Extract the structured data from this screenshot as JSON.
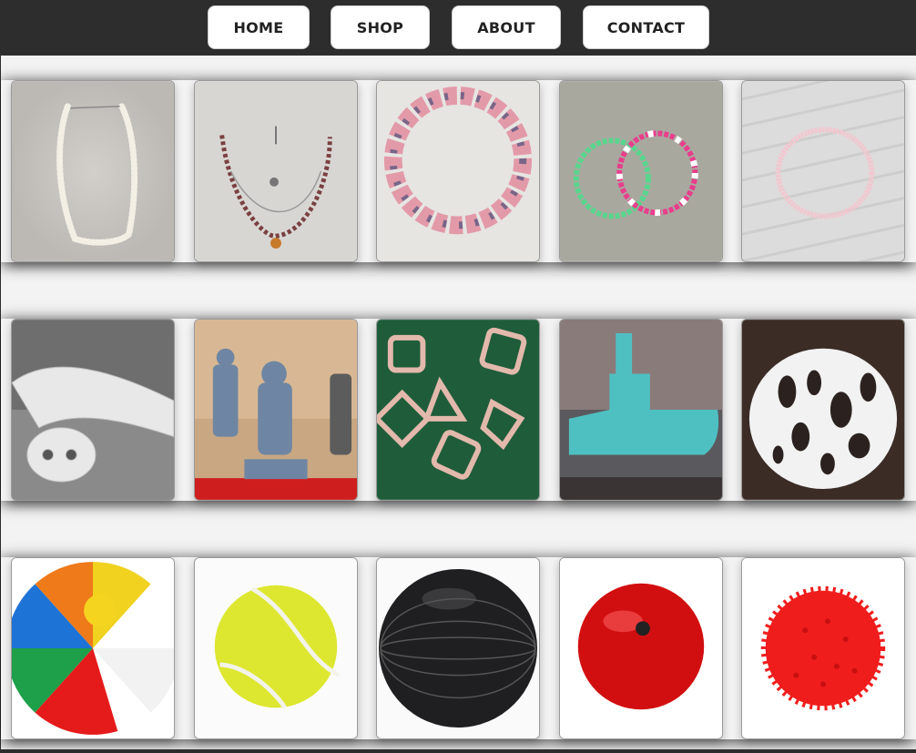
{
  "nav": {
    "items": [
      {
        "label": "HOME"
      },
      {
        "label": "SHOP"
      },
      {
        "label": "ABOUT"
      },
      {
        "label": "CONTACT"
      }
    ]
  },
  "rows": [
    {
      "items": [
        {
          "icon": "pearl-necklace-image"
        },
        {
          "icon": "beaded-pendant-necklace-image"
        },
        {
          "icon": "pink-bead-bracelet-image"
        },
        {
          "icon": "heart-letter-bracelets-image"
        },
        {
          "icon": "pink-seed-bracelet-image"
        }
      ]
    },
    {
      "items": [
        {
          "icon": "articulated-dragon-image"
        },
        {
          "icon": "miniature-soldiers-image"
        },
        {
          "icon": "lattice-dice-image"
        },
        {
          "icon": "benchy-boat-image"
        },
        {
          "icon": "voronoi-lamp-image"
        }
      ]
    },
    {
      "items": [
        {
          "icon": "beach-ball-image"
        },
        {
          "icon": "tennis-ball-image"
        },
        {
          "icon": "exercise-ball-image"
        },
        {
          "icon": "red-ball-image"
        },
        {
          "icon": "spiky-massage-ball-image"
        }
      ]
    }
  ],
  "colors": {
    "topbar": "#2d2d2d",
    "background": "#f3f3f3",
    "button": "#ffffff"
  }
}
